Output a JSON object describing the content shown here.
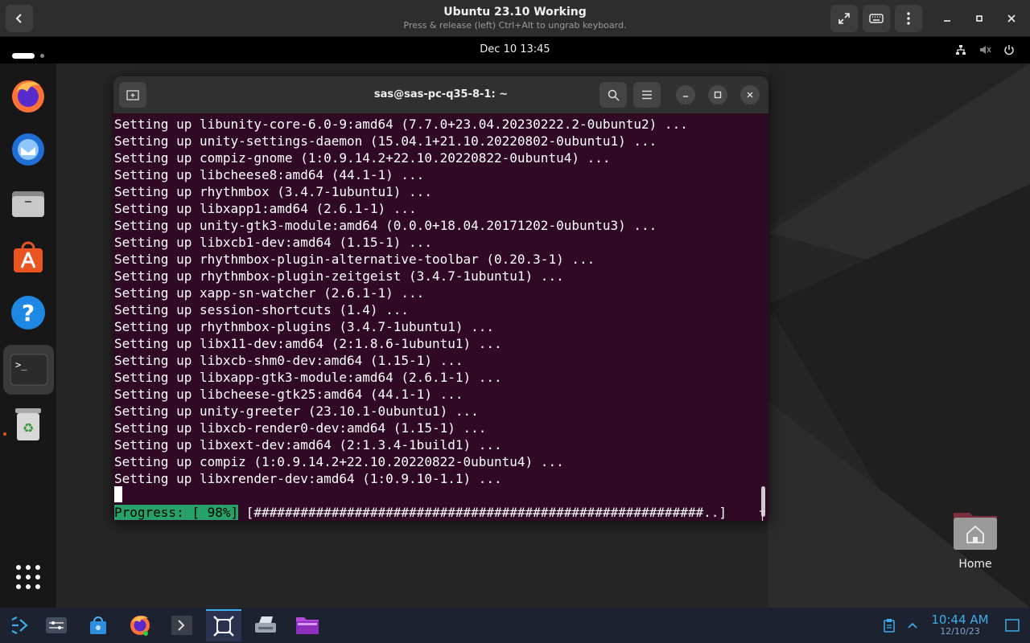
{
  "vm_header": {
    "title": "Ubuntu 23.10 Working",
    "subtitle": "Press & release (left) Ctrl+Alt to ungrab keyboard."
  },
  "top_bar": {
    "clock": "Dec 10  13:45"
  },
  "dock": {
    "apps": [
      "firefox",
      "thunderbird",
      "files",
      "app-center",
      "help",
      "terminal",
      "trash"
    ]
  },
  "terminal": {
    "title": "sas@sas-pc-q35-8-1: ~",
    "lines": [
      "Setting up libunity-core-6.0-9:amd64 (7.7.0+23.04.20230222.2-0ubuntu2) ...",
      "Setting up unity-settings-daemon (15.04.1+21.10.20220802-0ubuntu1) ...",
      "Setting up compiz-gnome (1:0.9.14.2+22.10.20220822-0ubuntu4) ...",
      "Setting up libcheese8:amd64 (44.1-1) ...",
      "Setting up rhythmbox (3.4.7-1ubuntu1) ...",
      "Setting up libxapp1:amd64 (2.6.1-1) ...",
      "Setting up unity-gtk3-module:amd64 (0.0.0+18.04.20171202-0ubuntu3) ...",
      "Setting up libxcb1-dev:amd64 (1.15-1) ...",
      "Setting up rhythmbox-plugin-alternative-toolbar (0.20.3-1) ...",
      "Setting up rhythmbox-plugin-zeitgeist (3.4.7-1ubuntu1) ...",
      "Setting up xapp-sn-watcher (2.6.1-1) ...",
      "Setting up session-shortcuts (1.4) ...",
      "Setting up rhythmbox-plugins (3.4.7-1ubuntu1) ...",
      "Setting up libx11-dev:amd64 (2:1.8.6-1ubuntu1) ...",
      "Setting up libxcb-shm0-dev:amd64 (1.15-1) ...",
      "Setting up libxapp-gtk3-module:amd64 (2.6.1-1) ...",
      "Setting up libcheese-gtk25:amd64 (44.1-1) ...",
      "Setting up unity-greeter (23.10.1-0ubuntu1) ...",
      "Setting up libxcb-render0-dev:amd64 (1.15-1) ...",
      "Setting up libxext-dev:amd64 (2:1.3.4-1build1) ...",
      "Setting up compiz (1:0.9.14.2+22.10.20220822-0ubuntu4) ...",
      "Setting up libxrender-dev:amd64 (1:0.9.10-1.1) ..."
    ],
    "progress_label": "Progress: [ 98%]",
    "progress_bar": " [##########################################################..]",
    "progress_value": 0.98
  },
  "desktop": {
    "home_label": "Home"
  },
  "taskbar": {
    "time": "10:44 AM",
    "date": "12/10/23"
  }
}
